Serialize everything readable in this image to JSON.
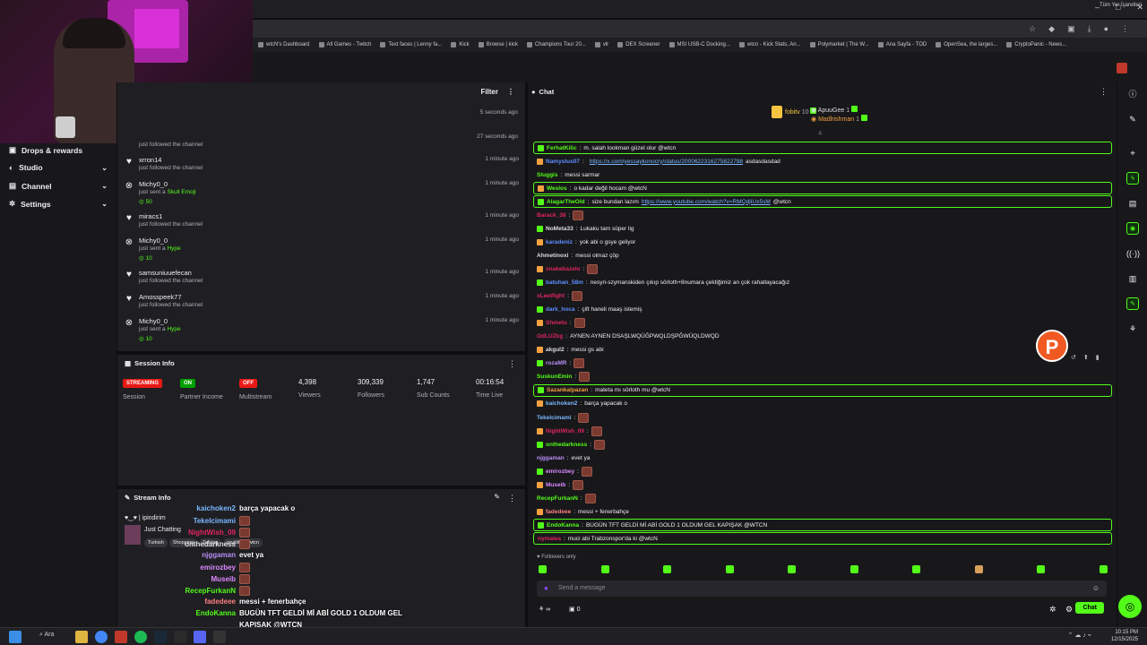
{
  "window": {
    "minimize": "–",
    "maximize": "□",
    "close": "✕"
  },
  "bookmarks": [
    "wtcN's Dashboard",
    "All Games - Twitch",
    "Text faces | Lenny fa...",
    "Kick",
    "Browse | kick",
    "Champions Tour 20...",
    "vlr",
    "DEX Screener",
    "MSI USB-C Docking...",
    "wtcn - Kick Stats, An...",
    "Polymarket | The W...",
    "Ana Sayfa - TOD",
    "OpenSea, the larges...",
    "CryptoPanic - News..."
  ],
  "bookmarks_all": "Tüm Yer İşaretleri",
  "sidebar": [
    {
      "label": "Drops & rewards",
      "chevron": false
    },
    {
      "label": "Studio",
      "chevron": true
    },
    {
      "label": "Channel",
      "chevron": true
    },
    {
      "label": "Settings",
      "chevron": true
    }
  ],
  "activity": {
    "filter_label": "Filter",
    "partial_top": [
      {
        "time": "5 seconds ago"
      },
      {
        "time": "27 seconds ago",
        "sub": "just followed the channel"
      }
    ],
    "items": [
      {
        "type": "follow",
        "name": "xrron14",
        "sub": "just followed the channel",
        "time": "1 minute ago"
      },
      {
        "type": "gift",
        "name": "Michy0_0",
        "sub": "just sent a",
        "gift": "Skull Emoji",
        "amount": "50",
        "time": "1 minute ago"
      },
      {
        "type": "follow",
        "name": "miracs1",
        "sub": "just followed the channel",
        "time": "1 minute ago"
      },
      {
        "type": "gift",
        "name": "Michy0_0",
        "sub": "just sent a",
        "gift": "Hype",
        "amount": "10",
        "time": "1 minute ago"
      },
      {
        "type": "follow",
        "name": "samsuniuuefecan",
        "sub": "just followed the channel",
        "time": "1 minute ago"
      },
      {
        "type": "follow",
        "name": "Amosspeek77",
        "sub": "just followed the channel",
        "time": "1 minute ago"
      },
      {
        "type": "gift",
        "name": "Michy0_0",
        "sub": "just sent a",
        "gift": "Hype",
        "amount": "10",
        "time": "1 minute ago"
      }
    ]
  },
  "session": {
    "title": "Session Info",
    "stats": [
      {
        "pill": "STREAMING",
        "pill_color": "#e91916",
        "label": "Session"
      },
      {
        "pill": "ON",
        "pill_color": "#00a000",
        "label": "Partner Income"
      },
      {
        "pill": "OFF",
        "pill_color": "#e91916",
        "label": "Multistream"
      },
      {
        "num": "4,398",
        "label": "Viewers"
      },
      {
        "num": "309,339",
        "label": "Followers"
      },
      {
        "num": "1,747",
        "label": "Sub Counts"
      },
      {
        "num": "00:16:54",
        "label": "Time Live"
      }
    ]
  },
  "stream_info": {
    "title": "Stream Info",
    "streamer": "♥‿♥ | ipindirim",
    "category": "Just Chatting",
    "tags": [
      "Turkish",
      "Shopping",
      "Talking",
      "pozitif",
      "wtcn"
    ]
  },
  "overlay_chat": [
    {
      "user": "kaichoken2",
      "color": "#7ab7ff",
      "text": "barça yapacak o"
    },
    {
      "user": "Tekelcimami",
      "color": "#7ab7ff",
      "text": "",
      "emote": true
    },
    {
      "user": "NightWish_09",
      "color": "#e0245e",
      "text": "",
      "emote": true
    },
    {
      "user": "onthedarkness",
      "color": "#dedede",
      "text": "",
      "emote": true
    },
    {
      "user": "njggaman",
      "color": "#b98cf5",
      "text": "evet ya"
    },
    {
      "user": "emirozbey",
      "color": "#dd88ff",
      "text": "",
      "emote": true
    },
    {
      "user": "Museib",
      "color": "#dd88ff",
      "text": "",
      "emote": true
    },
    {
      "user": "RecepFurkanN",
      "color": "#53fc18",
      "text": "",
      "emote": true
    },
    {
      "user": "fadedeee",
      "color": "#ff7f7f",
      "text": "messi + fenerbahçe"
    },
    {
      "user": "EndoKanna",
      "color": "#53fc18",
      "text": "BUGÜN TFT GELDİ Mİ ABİ GOLD 1 OLDUM GEL"
    },
    {
      "user": "",
      "color": "#fff",
      "text": "KAPIŞAK @WTCN"
    },
    {
      "user": "nymalea",
      "color": "#e0245e",
      "text": "muci abi Trabzonspor'da ki @wtcN"
    }
  ],
  "chat": {
    "title": "Chat",
    "header_users": [
      {
        "name": "fobitv",
        "num": "10",
        "color": "#f5c542"
      },
      {
        "name": "ApuuGee",
        "num": "1",
        "color": "#dedede"
      },
      {
        "name": "Madlrishman",
        "num": "1",
        "color": "#f5a142"
      }
    ],
    "messages": [
      {
        "user": "FerhatKilic",
        "color": "#53fc18",
        "text": "m. salah lookman güzel olur @wtcn",
        "hl": true
      },
      {
        "user": "Namyslus07",
        "color": "#5e8fff",
        "text": "",
        "link": "https://x.com/yessaykonocry/status/2000622316275822788",
        "after": " asdasdasdad"
      },
      {
        "user": "Sluggis",
        "color": "#53fc18",
        "text": "messi sarmar"
      },
      {
        "user": "Weslos",
        "color": "#53fc18",
        "text": "o kadar değil hocam @wtcN",
        "hl": true
      },
      {
        "user": "AlagarTheOld",
        "color": "#53fc18",
        "text": "size bundan lazım ",
        "link": "https://www.youtube.com/watch?v=RMQdjIUx5sM",
        "after": " @wtcn",
        "hl": true
      },
      {
        "user": "Barack_38",
        "color": "#e0245e",
        "text": "",
        "emote": true
      },
      {
        "user": "NoMeta33",
        "color": "#dedede",
        "text": "Lukaku tam süper lig"
      },
      {
        "user": "karadeniz",
        "color": "#5e8fff",
        "text": "yok abi o gsye geliyor"
      },
      {
        "user": "Ahmetinoxi",
        "color": "#dedede",
        "text": "messi olmaz çöp"
      },
      {
        "user": "snakebazelo",
        "color": "#e0245e",
        "text": "",
        "emote": true
      },
      {
        "user": "batuhan_58m",
        "color": "#5e8fff",
        "text": "nesyri-szymanskiden çıkıp sörloth+8numara çektiğimiz an çok rahatlayacağız"
      },
      {
        "user": "xLeetfight",
        "color": "#e0245e",
        "text": "",
        "emote": true
      },
      {
        "user": "dark_hoca",
        "color": "#5e8fff",
        "text": "çift haneli maaş istemiş"
      },
      {
        "user": "Shmetu",
        "color": "#e0245e",
        "text": "",
        "emote": true
      },
      {
        "user": "OdLUZkg",
        "color": "#e0245e",
        "text": "AYNEN AYNEN DSAŞLWQÜĞPWQLDŞPĞWÜQLDWQD"
      },
      {
        "user": "akgul2",
        "color": "#dedede",
        "text": "messi gs abi"
      },
      {
        "user": "rozaMR",
        "color": "#b98cf5",
        "text": "",
        "emote": true
      },
      {
        "user": "SuskunEmin",
        "color": "#53fc18",
        "text": "",
        "emote": true
      },
      {
        "user": "Sazankalpazan",
        "color": "#f5a142",
        "text": "mateta mı sörloth mu @wtcN",
        "hl": true
      },
      {
        "user": "kaichoken2",
        "color": "#7ab7ff",
        "text": "barça yapacak o"
      },
      {
        "user": "Tekelcimami",
        "color": "#7ab7ff",
        "text": "",
        "emote": true
      },
      {
        "user": "NightWish_09",
        "color": "#e0245e",
        "text": "",
        "emote": true
      },
      {
        "user": "onthedarkness",
        "color": "#53fc18",
        "text": "",
        "emote": true
      },
      {
        "user": "njggaman",
        "color": "#b98cf5",
        "text": "evet ya"
      },
      {
        "user": "emirozbey",
        "color": "#dd88ff",
        "text": "",
        "emote": true
      },
      {
        "user": "Museib",
        "color": "#dd88ff",
        "text": "",
        "emote": true
      },
      {
        "user": "RecepFurkanN",
        "color": "#53fc18",
        "text": "",
        "emote": true
      },
      {
        "user": "fadedeee",
        "color": "#ff7f7f",
        "text": "messi + fenerbahçe"
      },
      {
        "user": "EndoKanna",
        "color": "#53fc18",
        "text": "BUGÜN TFT GELDİ Mİ ABİ GOLD 1 OLDUM GEL KAPIŞAK @WTCN",
        "hl": true
      },
      {
        "user": "nymalea",
        "color": "#e0245e",
        "text": "muci abi Trabzonspor'da ki @wtcN",
        "hl": true
      }
    ],
    "followers_only": "Followers only",
    "placeholder": "Send a message",
    "points": "0",
    "send_label": "Chat"
  },
  "taskbar": {
    "search": "Ara",
    "time": "10:15 PM",
    "date": "12/15/2025"
  },
  "colors": {
    "accent": "#53fc18",
    "bg": "#0e0e10",
    "panel": "#1f1f23"
  }
}
